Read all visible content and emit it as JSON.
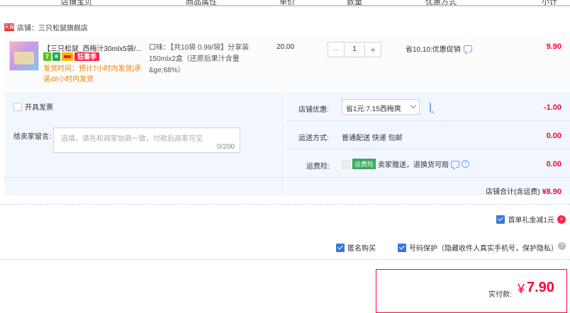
{
  "table_header": {
    "col_item": "店铺宝贝",
    "col_attr": "商品属性",
    "col_price": "单价",
    "col_qty": "数量",
    "col_promo": "优惠方式",
    "col_subtotal": "小计"
  },
  "shop": {
    "logo_text": "天猫",
    "name": "店铺：三只松鼠旗舰店"
  },
  "item": {
    "title": "【三只松鼠_西梅汁30mlx5袋/...",
    "badges": [
      "7",
      "⊕",
      "",
      "狂暑季"
    ],
    "shipping_note": "发货时间：预计7小时内发货|承诺48小时内发货",
    "attributes": "口味：【共10袋 0.99/袋】分享装150mlx2盒（还原后果汁含量&ge;68%）",
    "unit_price": "20.00",
    "quantity": "1",
    "qty_minus": "−",
    "qty_plus": "+",
    "promo": "省10.10:优惠促销",
    "subtotal": "9.90"
  },
  "options": {
    "invoice_label": "开具发票",
    "message_label": "给卖家留言:",
    "message_placeholder": "选填，请先和商家协商一致，付款后商家可见",
    "message_count": "0/200",
    "shop_discount_label": "店铺优惠:",
    "shop_discount_value": "省1元:7.15西梅爽",
    "shop_discount_amount": "-1.00",
    "shipping_label": "运送方式:",
    "shipping_value": "普通配送 快递 包邮",
    "shipping_amount": "0.00",
    "insurance_label": "运费险:",
    "insurance_badge": "运费险",
    "insurance_text": "卖家赠送，退换货可赔",
    "insurance_help": "?",
    "insurance_amount": "0.00",
    "shop_total_label": "店铺合计(含运费)",
    "shop_total_value": "¥8.90"
  },
  "extras": {
    "first_order": "首单礼金减1元",
    "bolt": "⚡",
    "anonymous": "匿名购买",
    "number_protect": "号码保护（隐藏收件人真实手机号，保护隐私）",
    "qmark": "?"
  },
  "payment": {
    "label": "实付款:",
    "currency": "¥",
    "amount": "7.90"
  }
}
